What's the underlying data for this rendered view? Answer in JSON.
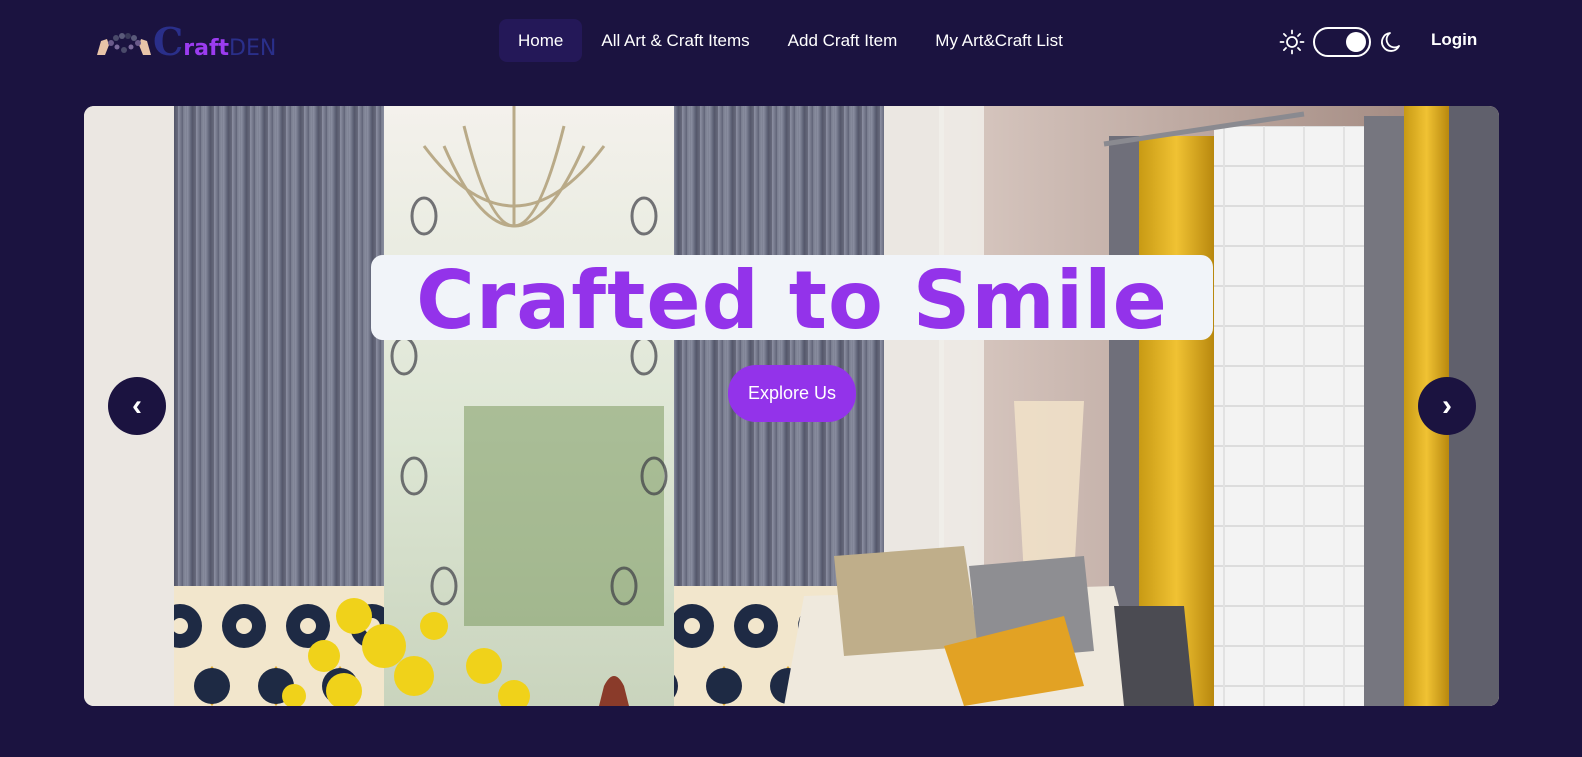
{
  "brand": {
    "logo_icon": "hands-holding-beads-icon",
    "initial": "C",
    "middle": "raft",
    "suffix": "DEN"
  },
  "nav": {
    "items": [
      {
        "label": "Home",
        "active": true
      },
      {
        "label": "All Art & Craft Items",
        "active": false
      },
      {
        "label": "Add Craft Item",
        "active": false
      },
      {
        "label": "My Art&Craft List",
        "active": false
      }
    ]
  },
  "theme": {
    "light_icon": "sun-icon",
    "dark_icon": "moon-icon",
    "toggle_on": true
  },
  "auth": {
    "login_label": "Login"
  },
  "hero": {
    "image": "curtains-living-room-photo",
    "headline": "Crafted to Smile",
    "cta_label": "Explore Us",
    "prev_label": "‹",
    "next_label": "›"
  },
  "colors": {
    "background": "#1b1340",
    "accent": "#9333ea",
    "active_nav": "#241858",
    "logo_blue": "#2a2f8a",
    "headline_box": "#f1f4f9"
  }
}
